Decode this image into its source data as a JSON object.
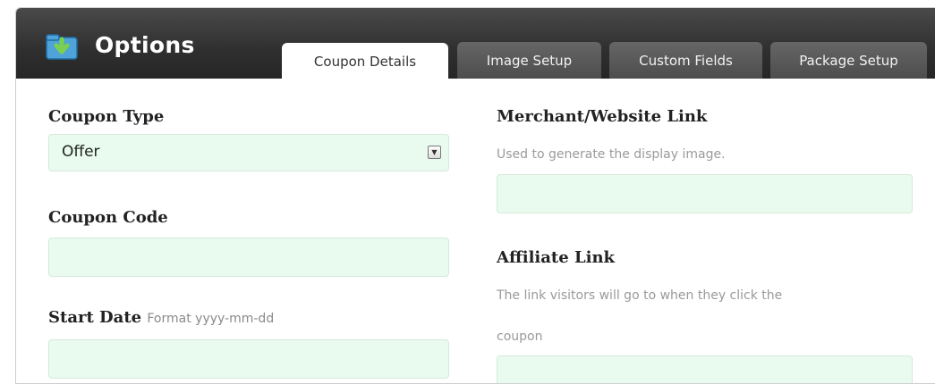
{
  "header": {
    "title": "Options",
    "icon": "folder-download-icon"
  },
  "tabs": [
    {
      "label": "Coupon Details",
      "active": true
    },
    {
      "label": "Image Setup",
      "active": false
    },
    {
      "label": "Custom Fields",
      "active": false
    },
    {
      "label": "Package Setup",
      "active": false
    }
  ],
  "left": {
    "coupon_type": {
      "label": "Coupon Type",
      "value": "Offer"
    },
    "coupon_code": {
      "label": "Coupon Code",
      "value": ""
    },
    "start_date": {
      "label": "Start Date",
      "format_hint": "Format yyyy-mm-dd",
      "value": ""
    }
  },
  "right": {
    "merchant_link": {
      "label": "Merchant/Website Link",
      "hint": "Used to generate the display image.",
      "value": ""
    },
    "affiliate_link": {
      "label": "Affiliate Link",
      "hint_line1": "The link visitors will go to when they click the",
      "hint_line2": "coupon",
      "value": ""
    }
  },
  "colors": {
    "header_bg": "#2f2f2f",
    "field_bg": "#e9fbee",
    "tab_inactive": "#555555"
  }
}
